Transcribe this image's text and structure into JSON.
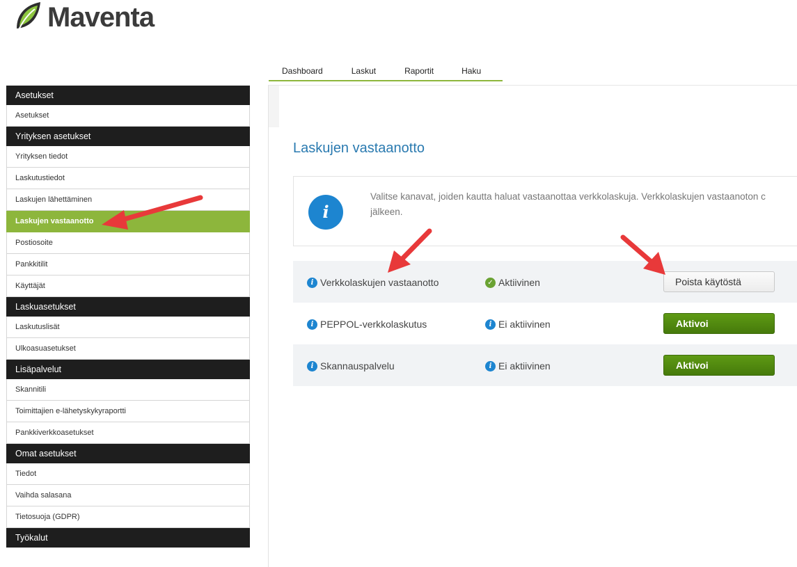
{
  "brand": {
    "name": "Maventa"
  },
  "topnav": {
    "tabs": [
      {
        "label": "Dashboard"
      },
      {
        "label": "Laskut"
      },
      {
        "label": "Raportit"
      },
      {
        "label": "Haku"
      }
    ]
  },
  "sidebar": {
    "sections": [
      {
        "title": "Asetukset",
        "items": [
          "Asetukset"
        ]
      },
      {
        "title": "Yrityksen asetukset",
        "items": [
          "Yrityksen tiedot",
          "Laskutustiedot",
          "Laskujen lähettäminen",
          "Laskujen vastaanotto",
          "Postiosoite",
          "Pankkitilit",
          "Käyttäjät"
        ]
      },
      {
        "title": "Laskuasetukset",
        "items": [
          "Laskutuslisät",
          "Ulkoasuasetukset"
        ]
      },
      {
        "title": "Lisäpalvelut",
        "items": [
          "Skannitili",
          "Toimittajien e-lähetyskykyraportti",
          "Pankkiverkkoasetukset"
        ]
      },
      {
        "title": "Omat asetukset",
        "items": [
          "Tiedot",
          "Vaihda salasana",
          "Tietosuoja (GDPR)"
        ]
      },
      {
        "title": "Työkalut",
        "items": []
      }
    ],
    "active_item": "Laskujen vastaanotto"
  },
  "main": {
    "title": "Laskujen vastaanotto",
    "info_line1": "Valitse kanavat, joiden kautta haluat vastaanottaa verkkolaskuja. Verkkolaskujen vastaanoton c",
    "info_line2": "jälkeen.",
    "channels": [
      {
        "name": "Verkkolaskujen vastaanotto",
        "status": "Aktiivinen",
        "active": true,
        "button": "Poista käytöstä"
      },
      {
        "name": "PEPPOL-verkkolaskutus",
        "status": "Ei aktiivinen",
        "active": false,
        "button": "Aktivoi"
      },
      {
        "name": "Skannauspalvelu",
        "status": "Ei aktiivinen",
        "active": false,
        "button": "Aktivoi"
      }
    ]
  },
  "colors": {
    "accent_green": "#8db63c",
    "button_green": "#4e8510",
    "title_blue": "#2a7ab0",
    "info_blue": "#1d85d0",
    "arrow_red": "#e8393a"
  }
}
